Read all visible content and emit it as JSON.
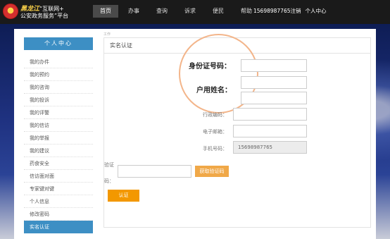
{
  "header": {
    "logo_brand": "黑龙江",
    "logo_line1_rest": "“互联网+",
    "logo_line2": "公安政务服务”平台",
    "nav": [
      {
        "label": "首页",
        "active": true
      },
      {
        "label": "办事",
        "active": false
      },
      {
        "label": "查询",
        "active": false
      },
      {
        "label": "诉求",
        "active": false
      },
      {
        "label": "便民",
        "active": false
      },
      {
        "label": "帮助",
        "active": false
      }
    ],
    "user": {
      "phone": "15698987765注销",
      "center": "个人中心"
    }
  },
  "sidebar": {
    "title": "个人中心",
    "items": [
      {
        "label": "我的办件",
        "active": false
      },
      {
        "label": "我的预约",
        "active": false
      },
      {
        "label": "我的咨询",
        "active": false
      },
      {
        "label": "我的投诉",
        "active": false
      },
      {
        "label": "我的评警",
        "active": false
      },
      {
        "label": "我的信访",
        "active": false
      },
      {
        "label": "我的举报",
        "active": false
      },
      {
        "label": "我的建议",
        "active": false
      },
      {
        "label": "药食安全",
        "active": false
      },
      {
        "label": "信访面对面",
        "active": false
      },
      {
        "label": "专家键对键",
        "active": false
      },
      {
        "label": "个人信息",
        "active": false
      },
      {
        "label": "修改密码",
        "active": false
      },
      {
        "label": "实名认证",
        "active": true
      }
    ]
  },
  "main": {
    "small_tag": "工作",
    "title": "实名认证",
    "id_label": "身份证号码：",
    "name_label": "户用姓名：",
    "postcode_label": "行政编码：",
    "email_label": "电子邮箱：",
    "phone_label": "手机号码：",
    "phone_value": "15698987765",
    "code_label_1": "验证",
    "code_label_2": "码：",
    "get_code_button": "获取验证码",
    "submit_button": "认证"
  },
  "colors": {
    "accent_blue": "#3d8fc4",
    "accent_orange": "#f39800",
    "code_button": "#f0a848",
    "circle": "#f3b58a"
  }
}
